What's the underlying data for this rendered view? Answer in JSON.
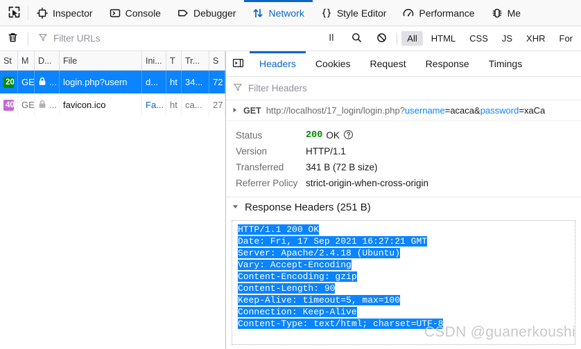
{
  "toolbox": {
    "picker_icon": "element-picker-icon",
    "tabs": [
      {
        "label": "Inspector",
        "icon": "inspector-icon",
        "selected": false
      },
      {
        "label": "Console",
        "icon": "console-icon",
        "selected": false
      },
      {
        "label": "Debugger",
        "icon": "debugger-icon",
        "selected": false
      },
      {
        "label": "Network",
        "icon": "network-icon",
        "selected": true
      },
      {
        "label": "Style Editor",
        "icon": "style-editor-icon",
        "selected": false
      },
      {
        "label": "Performance",
        "icon": "performance-icon",
        "selected": false
      },
      {
        "label": "Me",
        "icon": "memory-icon",
        "selected": false
      }
    ],
    "accent_color": "#0a65c9"
  },
  "network_toolbar": {
    "clear_icon": "trash-icon",
    "filter_icon": "funnel-icon",
    "filter_placeholder": "Filter URLs",
    "pause_icon": "pause-icon",
    "search_icon": "search-icon",
    "block_icon": "block-icon",
    "type_filters": [
      {
        "label": "All",
        "active": true
      },
      {
        "label": "HTML",
        "active": false
      },
      {
        "label": "CSS",
        "active": false
      },
      {
        "label": "JS",
        "active": false
      },
      {
        "label": "XHR",
        "active": false
      },
      {
        "label": "For",
        "active": false
      }
    ]
  },
  "request_list": {
    "columns": [
      "St",
      "M",
      "D...",
      "File",
      "Ini...",
      "T",
      "Tr...",
      "S"
    ],
    "rows": [
      {
        "status": "20",
        "status_kind": "ok",
        "method": "GE",
        "lock_icon": "lock-icon",
        "domain": "...",
        "file": "login.php?usern",
        "initiator": "d...",
        "type": "ht",
        "transferred": "34...",
        "size": "72",
        "selected": true
      },
      {
        "status": "40",
        "status_kind": "notfound",
        "method": "GE",
        "lock_icon": "lock-icon",
        "domain": "...",
        "file": "favicon.ico",
        "initiator": "Fa...",
        "type": "ht",
        "transferred": "ca...",
        "size": "27",
        "selected": false
      }
    ]
  },
  "details": {
    "back_icon": "panel-collapse-icon",
    "tabs": [
      {
        "label": "Headers",
        "selected": true
      },
      {
        "label": "Cookies",
        "selected": false
      },
      {
        "label": "Request",
        "selected": false
      },
      {
        "label": "Response",
        "selected": false
      },
      {
        "label": "Timings",
        "selected": false
      }
    ],
    "filter_icon": "funnel-icon",
    "filter_placeholder": "Filter Headers",
    "url": {
      "expand_icon": "triangle-right-icon",
      "method": "GET",
      "base": "http://localhost/17_login/login.php",
      "query_sep": "?",
      "param1_key": "username",
      "param1_eq": "=",
      "param1_val": "acaca",
      "amp": "&",
      "param2_key": "password",
      "param2_eq": "=",
      "param2_val": "xaCa"
    },
    "summary": [
      {
        "label": "Status",
        "value": "200",
        "value_suffix": "OK",
        "help_icon": "help-circle-icon",
        "kind": "status"
      },
      {
        "label": "Version",
        "value": "HTTP/1.1",
        "kind": "plain"
      },
      {
        "label": "Transferred",
        "value": "341 B (72 B size)",
        "kind": "plain"
      },
      {
        "label": "Referrer Policy",
        "value": "strict-origin-when-cross-origin",
        "kind": "plain"
      }
    ],
    "response_headers": {
      "collapse_icon": "triangle-down-icon",
      "title": "Response Headers (251 B)",
      "raw_lines": [
        "HTTP/1.1 200 OK",
        "Date: Fri, 17 Sep 2021 16:27:21 GMT",
        "Server: Apache/2.4.18 (Ubuntu)",
        "Vary: Accept-Encoding",
        "Content-Encoding: gzip",
        "Content-Length: 90",
        "Keep-Alive: timeout=5, max=100",
        "Connection: Keep-Alive",
        "Content-Type: text/html; charset=UTF-8"
      ],
      "selection_color": "#0a84ff"
    }
  },
  "watermark": "CSDN @guanerkoushi",
  "colors": {
    "accent": "#0a65c9",
    "selection": "#0a84ff",
    "status_ok": "#058b00",
    "status_notfound": "#c767d6",
    "status_text_green": "#058b00"
  }
}
